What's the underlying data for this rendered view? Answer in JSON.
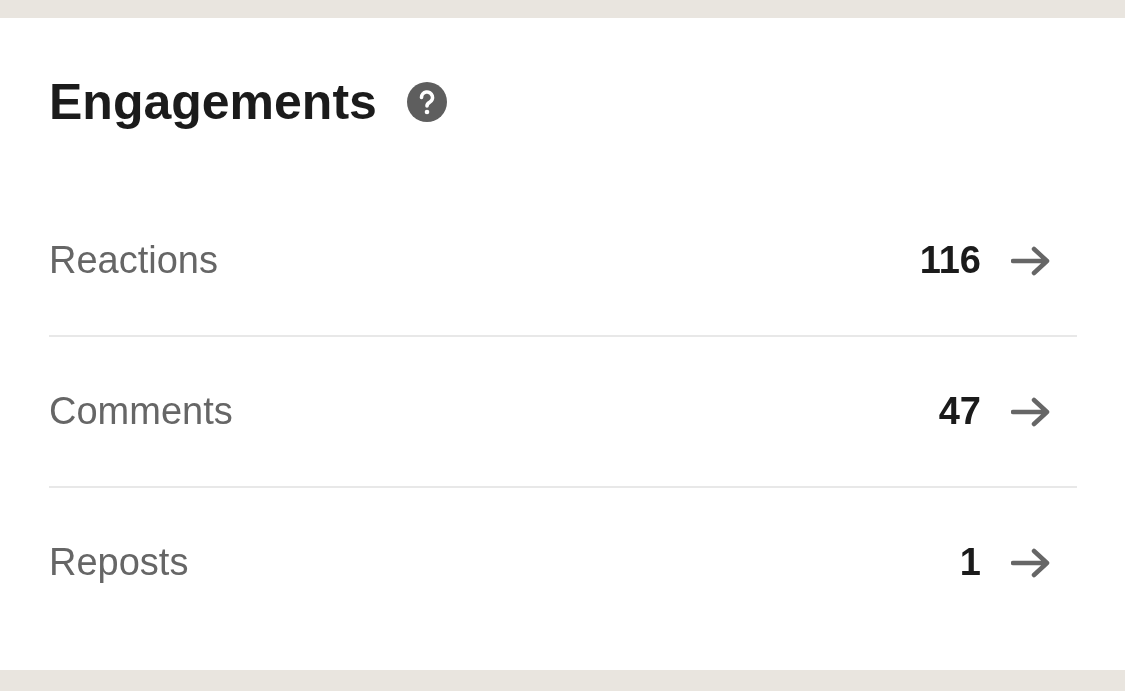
{
  "title": "Engagements",
  "rows": [
    {
      "label": "Reactions",
      "value": "116"
    },
    {
      "label": "Comments",
      "value": "47"
    },
    {
      "label": "Reposts",
      "value": "1"
    }
  ]
}
